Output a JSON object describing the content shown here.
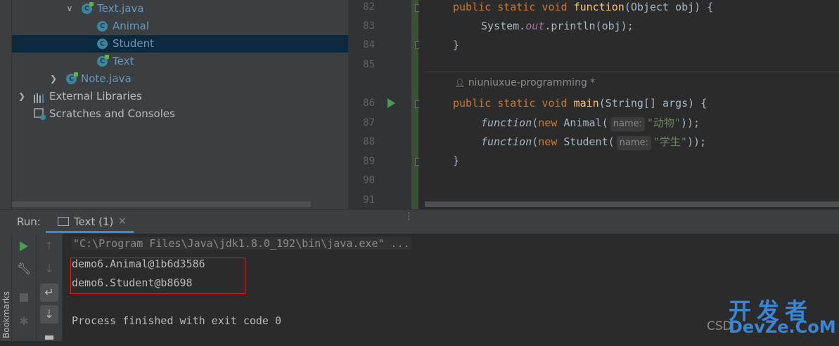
{
  "sidebar": {
    "bookmarks_label": "Bookmarks"
  },
  "project_tree": {
    "items": [
      {
        "label": "Text.java",
        "icon": "java-class-icon",
        "expanded": true
      },
      {
        "label": "Animal",
        "icon": "class-icon"
      },
      {
        "label": "Student",
        "icon": "class-icon",
        "selected": true
      },
      {
        "label": "Text",
        "icon": "class-run-icon"
      },
      {
        "label": "Note.java",
        "icon": "java-class-icon",
        "expanded": false
      },
      {
        "label": "External Libraries",
        "icon": "library-icon"
      },
      {
        "label": "Scratches and Consoles",
        "icon": "scratch-icon"
      }
    ]
  },
  "editor": {
    "line_numbers": [
      "82",
      "83",
      "84",
      "85",
      "86",
      "87",
      "88",
      "89",
      "90",
      "91"
    ],
    "author_hint": "niuniuxue-programming *",
    "code": {
      "l82": {
        "kw": "public static void",
        "fn": "function",
        "rest": "(Object obj) {"
      },
      "l83": {
        "a": "System.",
        "b": "out",
        "c": ".println(obj);"
      },
      "l84": "}",
      "l86": {
        "kw": "public static void",
        "fn": "main",
        "rest": "(String[] args) {"
      },
      "l87": {
        "call": "function",
        "kw": "new",
        "cls": "Animal(",
        "hint": "name:",
        "str": "\"动物\"",
        "end": "));"
      },
      "l88": {
        "call": "function",
        "kw": "new",
        "cls": "Student(",
        "hint": "name:",
        "str": "\"学生\"",
        "end": "));"
      },
      "l89": "}"
    }
  },
  "run_panel": {
    "label": "Run:",
    "tab_label": "Text (1)",
    "tab_close": "×",
    "console": {
      "command": "\"C:\\Program Files\\Java\\jdk1.8.0_192\\bin\\java.exe\" ...",
      "output": [
        "demo6.Animal@1b6d3586",
        "demo6.Student@b8698"
      ],
      "exit": "Process finished with exit code 0"
    }
  },
  "watermark": {
    "csd": "CSD",
    "cn": "开发者",
    "en": "DevZe.CoM"
  },
  "colors": {
    "accent_blue": "#4a88c7",
    "selection": "#0d293e",
    "highlight_box": "#e02020",
    "keyword": "#cc7832",
    "function": "#ffc66d",
    "string": "#6a8759"
  }
}
